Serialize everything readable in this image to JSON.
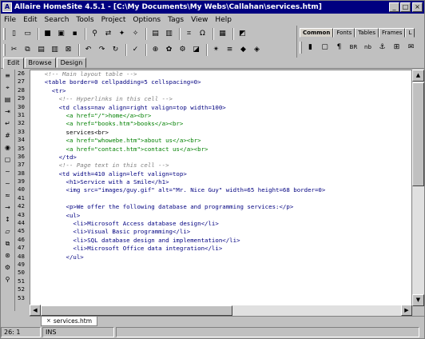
{
  "window": {
    "title": "Allaire HomeSite 4.5.1 - [C:\\My Documents\\My Webs\\Callahan\\services.htm]"
  },
  "menu": [
    {
      "label": "File"
    },
    {
      "label": "Edit"
    },
    {
      "label": "Search"
    },
    {
      "label": "Tools"
    },
    {
      "label": "Project"
    },
    {
      "label": "Options"
    },
    {
      "label": "Tags"
    },
    {
      "label": "View"
    },
    {
      "label": "Help"
    }
  ],
  "tag_toolbar": {
    "tabs": [
      {
        "label": "Common"
      },
      {
        "label": "Fonts"
      },
      {
        "label": "Tables"
      },
      {
        "label": "Frames"
      },
      {
        "label": "L"
      }
    ]
  },
  "edit_tabs": [
    {
      "label": "Edit"
    },
    {
      "label": "Browse"
    },
    {
      "label": "Design"
    }
  ],
  "editor": {
    "lines": [
      {
        "num": "26",
        "text": "    <!-- Main layout table -->",
        "kind": "comment"
      },
      {
        "num": "27",
        "text": "    <table border=0 cellpadding=5 cellspacing=0>",
        "kind": "tag"
      },
      {
        "num": "28",
        "text": "      <tr>",
        "kind": "tag"
      },
      {
        "num": "29",
        "text": "        <!-- Hyperlinks in this cell -->",
        "kind": "comment"
      },
      {
        "num": "30",
        "text": "        <td class=nav align=right valign=top width=100>",
        "kind": "tag"
      },
      {
        "num": "31",
        "text": "          <a href=\"/\">home</a><br>",
        "kind": "anchor"
      },
      {
        "num": "32",
        "text": "          <a href=\"books.htm\">books</a><br>",
        "kind": "anchor"
      },
      {
        "num": "33",
        "text": "          services<br>",
        "kind": "text"
      },
      {
        "num": "34",
        "text": "          <a href=\"whowebe.htm\">about us</a><br>",
        "kind": "anchor"
      },
      {
        "num": "35",
        "text": "          <a href=\"contact.htm\">contact us</a><br>",
        "kind": "anchor"
      },
      {
        "num": "36",
        "text": "        </td>",
        "kind": "tag"
      },
      {
        "num": "37",
        "text": "        <!-- Page text in this cell -->",
        "kind": "comment"
      },
      {
        "num": "38",
        "text": "        <td width=410 align=left valign=top>",
        "kind": "tag"
      },
      {
        "num": "39",
        "text": "          <h1>Service with a Smile</h1>",
        "kind": "tag"
      },
      {
        "num": "40",
        "text": "          <img src=\"images/guy.gif\" alt=\"Mr. Nice Guy\" width=65 height=68 border=0>",
        "kind": "tag"
      },
      {
        "num": "41",
        "text": "",
        "kind": "text"
      },
      {
        "num": "42",
        "text": "          <p>We offer the following database and programming services:</p>",
        "kind": "tag"
      },
      {
        "num": "43",
        "text": "          <ul>",
        "kind": "tag"
      },
      {
        "num": "44",
        "text": "            <li>Microsoft Access database design</li>",
        "kind": "tag"
      },
      {
        "num": "45",
        "text": "            <li>Visual Basic programming</li>",
        "kind": "tag"
      },
      {
        "num": "46",
        "text": "            <li>SQL database design and implementation</li>",
        "kind": "tag"
      },
      {
        "num": "47",
        "text": "            <li>Microsoft Office data integration</li>",
        "kind": "tag"
      },
      {
        "num": "48",
        "text": "          </ul>",
        "kind": "tag"
      },
      {
        "num": "49",
        "text": "",
        "kind": "text"
      },
      {
        "num": "50",
        "text": "",
        "kind": "text"
      },
      {
        "num": "51",
        "text": "",
        "kind": "text"
      },
      {
        "num": "52",
        "text": "",
        "kind": "text"
      },
      {
        "num": "53",
        "text": "",
        "kind": "text"
      }
    ]
  },
  "document_tabs": [
    {
      "label": "services.htm"
    }
  ],
  "status": {
    "position": "26: 1",
    "mode": "INS"
  },
  "colors": {
    "titlebar": "#000080",
    "chrome": "#c0c0c0",
    "comment": "#808080",
    "tag": "#000080",
    "anchor": "#008000"
  }
}
